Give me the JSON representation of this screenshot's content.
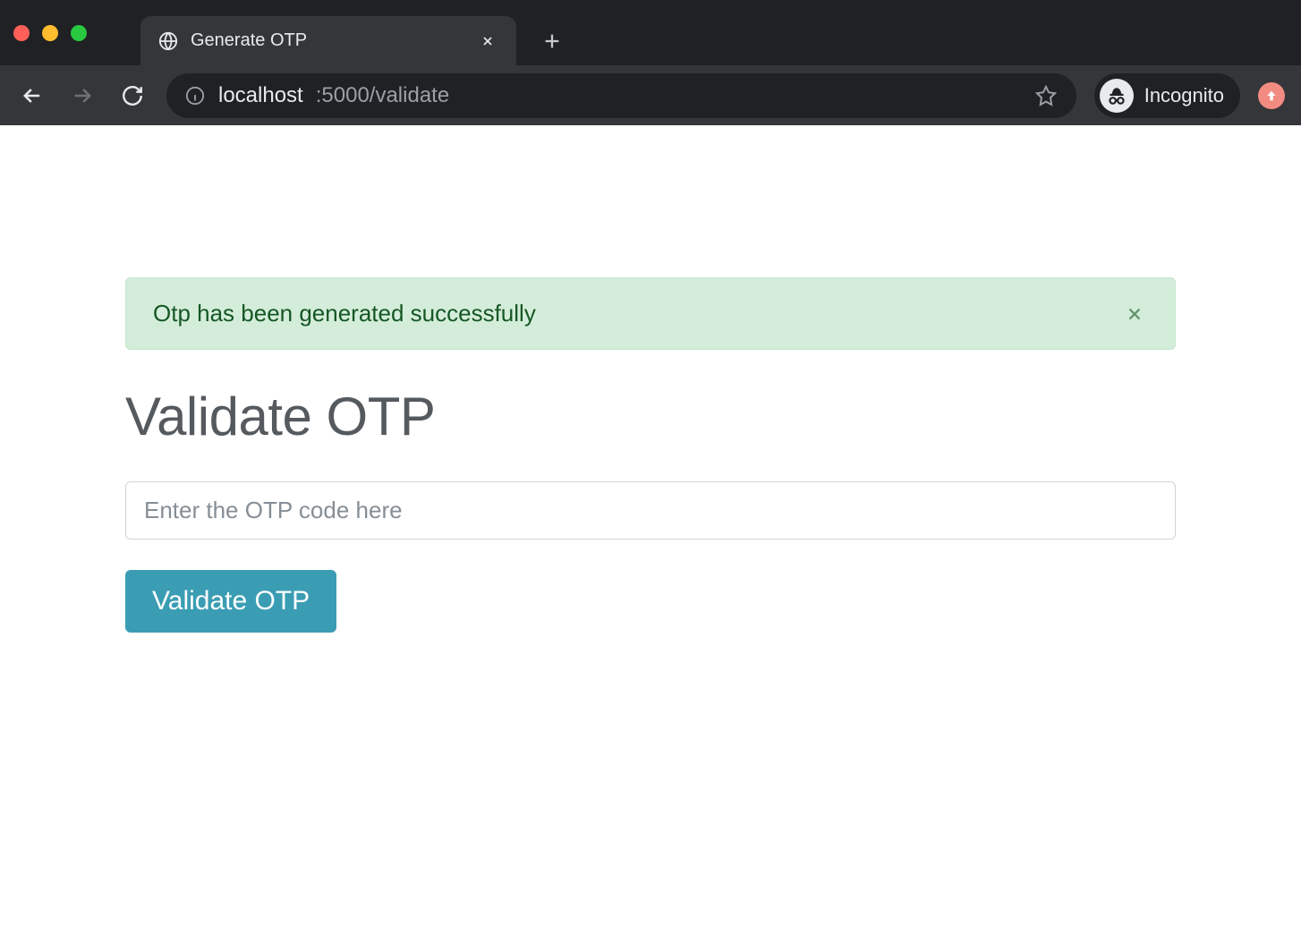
{
  "browser": {
    "tab_title": "Generate OTP",
    "url_host": "localhost",
    "url_rest": ":5000/validate",
    "incognito_label": "Incognito"
  },
  "alert": {
    "message": "Otp has been generated successfully"
  },
  "main": {
    "heading": "Validate OTP",
    "input_placeholder": "Enter the OTP code here",
    "input_value": "",
    "submit_label": "Validate OTP"
  }
}
